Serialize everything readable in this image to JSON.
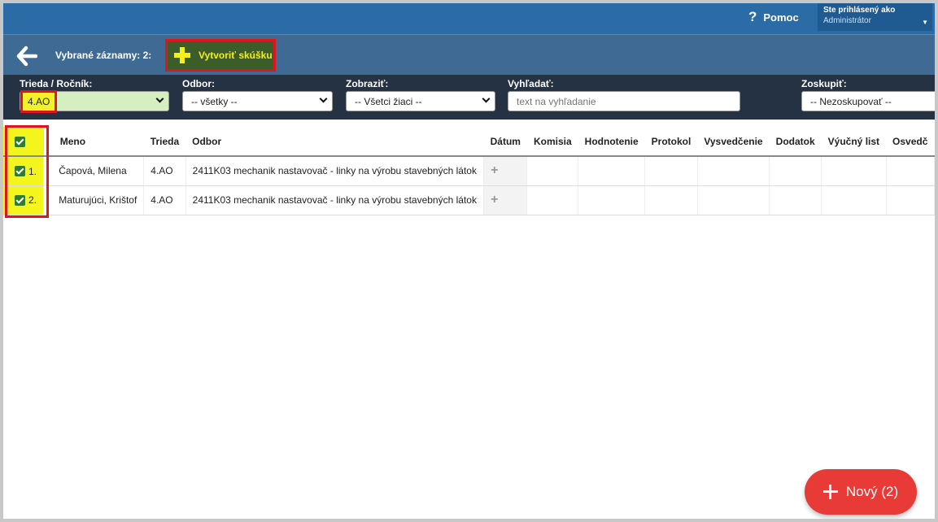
{
  "header": {
    "help_icon": "?",
    "help_label": "Pomoc",
    "user_line1": "Ste prihlásený ako",
    "user_line2": "Administrátor"
  },
  "actionbar": {
    "selected_label": "Vybrané záznamy: 2:",
    "create_label": "Vytvoriť skúšku"
  },
  "filters": {
    "trieda_label": "Trieda / Ročník:",
    "trieda_value": "4.AO",
    "odbor_label": "Odbor:",
    "odbor_value": "-- všetky --",
    "zobrazit_label": "Zobraziť:",
    "zobrazit_value": "-- Všetci žiaci --",
    "vyhladat_label": "Vyhľadať:",
    "vyhladat_placeholder": "text na vyhľadanie",
    "zoskupit_label": "Zoskupiť:",
    "zoskupit_value": "-- Nezoskupovať --"
  },
  "table": {
    "columns": [
      "Meno",
      "Trieda",
      "Odbor",
      "Dátum",
      "Komisia",
      "Hodnotenie",
      "Protokol",
      "Vysvedčenie",
      "Dodatok",
      "Výučný list",
      "Osvedč"
    ],
    "rows": [
      {
        "num": "1.",
        "meno": "Čapová, Milena",
        "trieda": "4.AO",
        "odbor": "2411K03 mechanik nastavovač - linky na výrobu stavebných látok",
        "datum_icon": "+"
      },
      {
        "num": "2.",
        "meno": "Maturujúci, Krištof",
        "trieda": "4.AO",
        "odbor": "2411K03 mechanik nastavovač - linky na výrobu stavebných látok",
        "datum_icon": "+"
      }
    ]
  },
  "fab": {
    "label": "Nový (2)"
  },
  "colors": {
    "topbar": "#2b6ca6",
    "actionbar": "#3f6a93",
    "filterbar": "#253243",
    "highlight": "#f5f51e",
    "outline": "#e0141e",
    "fab": "#e83b37"
  }
}
